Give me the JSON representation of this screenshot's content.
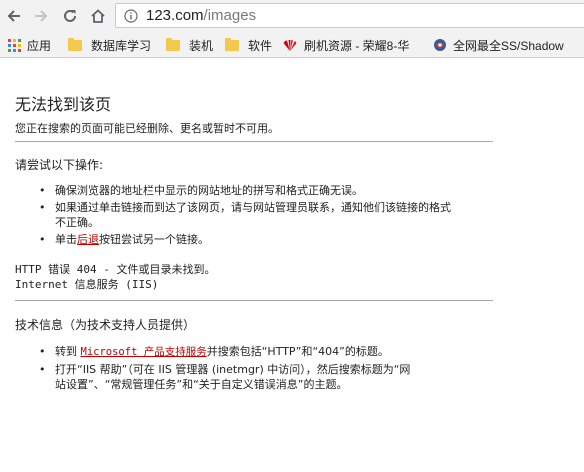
{
  "browser": {
    "url_host": "123.com",
    "url_path": "/images",
    "bookmarks": [
      {
        "label": "应用",
        "icon": "apps-grid-icon"
      },
      {
        "label": "数据库学习",
        "icon": "folder-icon"
      },
      {
        "label": "装机",
        "icon": "folder-icon"
      },
      {
        "label": "软件",
        "icon": "folder-icon"
      },
      {
        "label": "刷机资源 - 荣耀8-华",
        "icon": "huawei-logo-icon"
      },
      {
        "label": "全网最全SS/Shadow",
        "icon": "site-favicon-icon"
      }
    ]
  },
  "page": {
    "title": "无法找到该页",
    "description": "您正在搜索的页面可能已经删除、更名或暂时不可用。",
    "try_heading": "请尝试以下操作:",
    "try_items": {
      "item1": "确保浏览器的地址栏中显示的网站地址的拼写和格式正确无误。",
      "item2_line1": "如果通过单击链接而到达了该网页，请与网站管理员联系，通知他们该链接的格式",
      "item2_line2": "不正确。",
      "item3_pre": "单击",
      "item3_link": "后退",
      "item3_post": "按钮尝试另一个链接。"
    },
    "http_error": "HTTP 错误 404 - 文件或目录未找到。",
    "iis_line": "Internet 信息服务 (IIS)",
    "tech_heading": "技术信息（为技术支持人员提供）",
    "tech_items": {
      "item1_pre": "转到",
      "item1_link": "Microsoft 产品支持服务",
      "item1_post": "并搜索包括“HTTP”和“404”的标题。",
      "item2_line1": "打开“IIS 帮助”（可在 IIS 管理器 (inetmgr) 中访问），然后搜索标题为“网",
      "item2_line2": "站设置”、“常规管理任务”和“关于自定义错误消息”的主题。"
    }
  }
}
